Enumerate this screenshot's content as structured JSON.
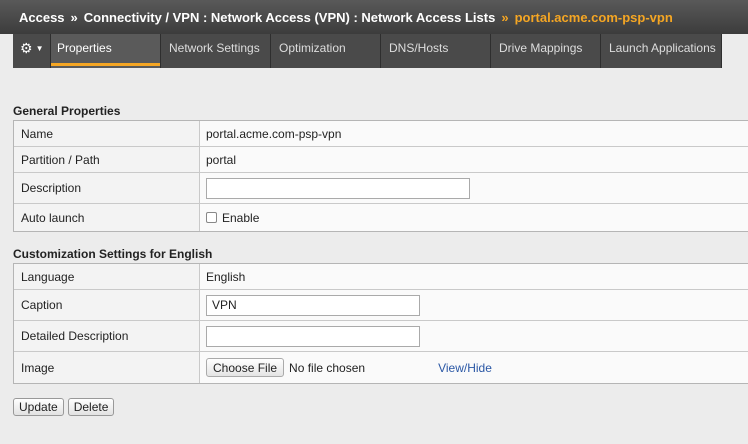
{
  "breadcrumb": {
    "items": [
      "Access",
      "Connectivity / VPN : Network Access (VPN) : Network Access Lists",
      "portal.acme.com-psp-vpn"
    ],
    "separator": "»"
  },
  "tabs": {
    "gear_icon": "gear-icon",
    "items": [
      {
        "label": "Properties",
        "active": true
      },
      {
        "label": "Network Settings",
        "active": false
      },
      {
        "label": "Optimization",
        "active": false
      },
      {
        "label": "DNS/Hosts",
        "active": false
      },
      {
        "label": "Drive Mappings",
        "active": false
      },
      {
        "label": "Launch Applications",
        "active": false
      }
    ]
  },
  "general": {
    "title": "General Properties",
    "name_label": "Name",
    "name_value": "portal.acme.com-psp-vpn",
    "partition_label": "Partition / Path",
    "partition_value": "portal",
    "description_label": "Description",
    "description_value": "",
    "autolaunch_label": "Auto launch",
    "autolaunch_checkbox_label": "Enable",
    "autolaunch_checked": false
  },
  "custom": {
    "title": "Customization Settings for English",
    "language_label": "Language",
    "language_value": "English",
    "caption_label": "Caption",
    "caption_value": "VPN",
    "detailed_label": "Detailed Description",
    "detailed_value": "",
    "image_label": "Image",
    "choose_file": "Choose File",
    "no_file": "No file chosen",
    "view_hide": "View/Hide"
  },
  "actions": {
    "update": "Update",
    "delete": "Delete"
  },
  "colors": {
    "accent": "#f5a623",
    "link": "#2a57a5"
  }
}
